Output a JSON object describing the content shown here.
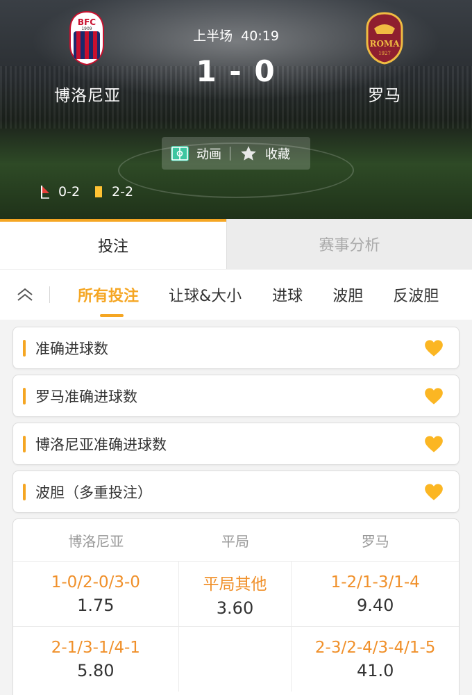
{
  "match": {
    "period": "上半场",
    "clock": "40:19",
    "score": "1 - 0",
    "home": {
      "name": "博洛尼亚",
      "crest_text": "BFC",
      "crest_year": "1909"
    },
    "away": {
      "name": "罗马",
      "crest_text": "ROMA",
      "crest_year": "1927"
    }
  },
  "actions": {
    "animation_label": "动画",
    "favorite_label": "收藏"
  },
  "stats": {
    "corners": "0-2",
    "yellow_cards": "2-2"
  },
  "main_tabs": [
    {
      "label": "投注",
      "active": true
    },
    {
      "label": "赛事分析",
      "active": false
    }
  ],
  "subnav": [
    {
      "label": "所有投注",
      "active": true
    },
    {
      "label": "让球&大小",
      "active": false
    },
    {
      "label": "进球",
      "active": false
    },
    {
      "label": "波胆",
      "active": false
    },
    {
      "label": "反波胆",
      "active": false
    }
  ],
  "markets": [
    {
      "title": "准确进球数"
    },
    {
      "title": "罗马准确进球数"
    },
    {
      "title": "博洛尼亚准确进球数"
    },
    {
      "title": "波胆（多重投注）"
    }
  ],
  "odds_table": {
    "headers": [
      "博洛尼亚",
      "平局",
      "罗马"
    ],
    "rows": [
      [
        {
          "label": "1-0/2-0/3-0",
          "value": "1.75"
        },
        {
          "label": "平局其他",
          "value": "3.60"
        },
        {
          "label": "1-2/1-3/1-4",
          "value": "9.40"
        }
      ],
      [
        {
          "label": "2-1/3-1/4-1",
          "value": "5.80"
        },
        {
          "label": "",
          "value": ""
        },
        {
          "label": "2-3/2-4/3-4/1-5",
          "value": "41.0"
        }
      ]
    ]
  },
  "colors": {
    "accent": "#f5a623",
    "odds_label": "#f0902a"
  }
}
